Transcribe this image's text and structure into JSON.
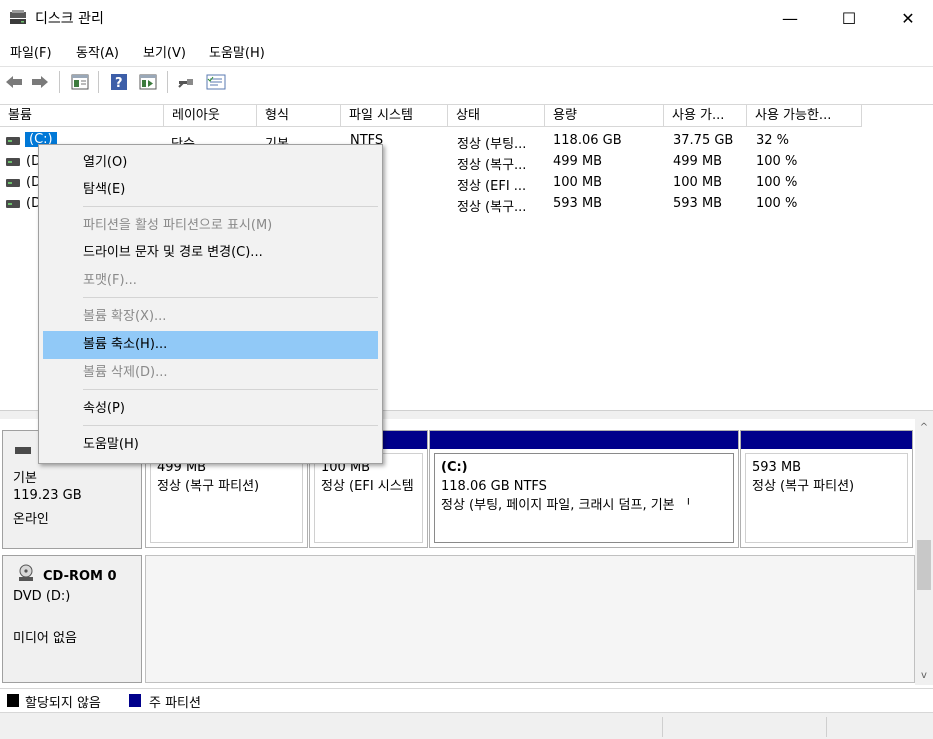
{
  "window": {
    "title": "디스크 관리",
    "minimize": "—",
    "maximize": "☐",
    "close": "✕"
  },
  "menubar": [
    "파일(F)",
    "동작(A)",
    "보기(V)",
    "도움말(H)"
  ],
  "toolbar": {
    "icons": [
      "back-arrow-icon",
      "forward-arrow-icon",
      "view-list-icon",
      "help-icon",
      "view-detail-icon",
      "connect-icon",
      "properties-icon"
    ]
  },
  "volume_list": {
    "columns": [
      "볼륨",
      "레이아웃",
      "형식",
      "파일 시스템",
      "상태",
      "용량",
      "사용 가...",
      "사용 가능한..."
    ],
    "rows": [
      {
        "volume": "(C:)",
        "layout": "단순",
        "type": "기본",
        "fs": "NTFS",
        "status": "정상 (부팅...",
        "capacity": "118.06 GB",
        "free": "37.75 GB",
        "pct": "32 %"
      },
      {
        "volume": "(D",
        "layout": "",
        "type": "",
        "fs": "",
        "status": "정상 (복구...",
        "capacity": "499 MB",
        "free": "499 MB",
        "pct": "100 %"
      },
      {
        "volume": "(D",
        "layout": "",
        "type": "",
        "fs": "",
        "status": "정상 (EFI ...",
        "capacity": "100 MB",
        "free": "100 MB",
        "pct": "100 %"
      },
      {
        "volume": "(D",
        "layout": "",
        "type": "",
        "fs": "",
        "status": "정상 (복구...",
        "capacity": "593 MB",
        "free": "593 MB",
        "pct": "100 %"
      }
    ]
  },
  "context_menu": {
    "items": [
      {
        "label": "열기(O)",
        "disabled": false
      },
      {
        "label": "탐색(E)",
        "disabled": false
      },
      {
        "label": "파티션을 활성 파티션으로 표시(M)",
        "disabled": true
      },
      {
        "label": "드라이브 문자 및 경로 변경(C)...",
        "disabled": false
      },
      {
        "label": "포맷(F)...",
        "disabled": true
      },
      {
        "label": "볼륨 확장(X)...",
        "disabled": true
      },
      {
        "label": "볼륨 축소(H)...",
        "disabled": false,
        "highlighted": true
      },
      {
        "label": "볼륨 삭제(D)...",
        "disabled": true
      },
      {
        "label": "속성(P)",
        "disabled": false
      },
      {
        "label": "도움말(H)",
        "disabled": false
      }
    ]
  },
  "disk0": {
    "label_type": "기본",
    "size": "119.23 GB",
    "status": "온라인",
    "partitions": [
      {
        "name": "",
        "size": "499 MB",
        "status": "정상 (복구 파티션)"
      },
      {
        "name": "",
        "size": "100 MB",
        "status": "정상 (EFI 시스템"
      },
      {
        "name": "(C:)",
        "size": "118.06 GB NTFS",
        "status": "정상 (부팅, 페이지 파일, 크래시 덤프, 기본 ᅵ"
      },
      {
        "name": "",
        "size": "593 MB",
        "status": "정상 (복구 파티션)"
      }
    ]
  },
  "cdrom": {
    "title": "CD-ROM 0",
    "drive": "DVD (D:)",
    "media": "미디어 없음"
  },
  "legend": {
    "unallocated": "할당되지 않음",
    "primary": "주 파티션",
    "unallocated_color": "#000000",
    "primary_color": "#00008b"
  },
  "colors": {
    "partition_bar": "#00008b",
    "menu_highlight": "#91c9f7",
    "selected_volume": "#0078d7"
  }
}
